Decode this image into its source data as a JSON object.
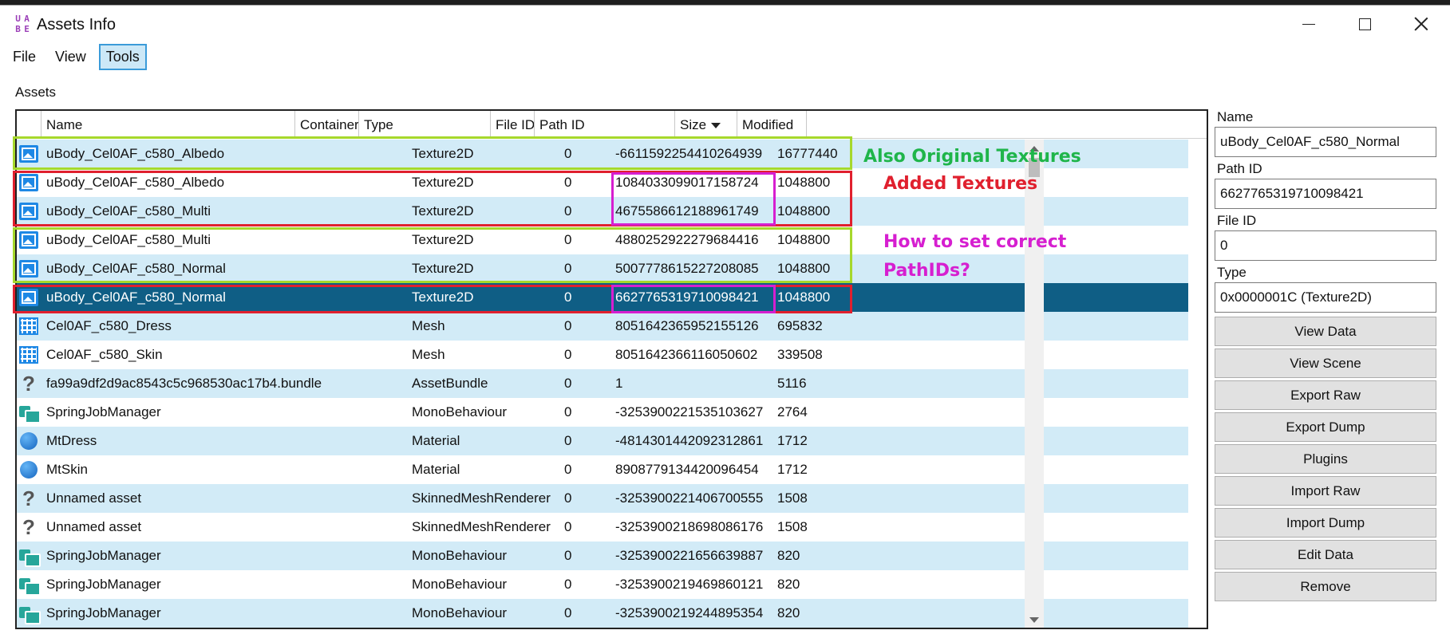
{
  "window": {
    "title": "Assets Info",
    "icon_letters": [
      "U",
      "A",
      "B",
      "E"
    ],
    "controls": [
      "minimize-icon",
      "maximize-icon",
      "close-icon"
    ]
  },
  "menu": {
    "items": [
      "File",
      "View",
      "Tools"
    ],
    "active": "Tools"
  },
  "assets_label": "Assets",
  "table": {
    "columns": [
      "Name",
      "Container",
      "Type",
      "File ID",
      "Path ID",
      "Size",
      "Modified"
    ],
    "sort_column": "Size",
    "rows": [
      {
        "icon": "texture-icon",
        "name": "uBody_Cel0AF_c580_Albedo",
        "container": "",
        "type": "Texture2D",
        "file_id": "0",
        "path_id": "-6611592254410264939",
        "size": "16777440"
      },
      {
        "icon": "texture-icon",
        "name": "uBody_Cel0AF_c580_Albedo",
        "container": "",
        "type": "Texture2D",
        "file_id": "0",
        "path_id": "1084033099017158724",
        "size": "1048800"
      },
      {
        "icon": "texture-icon",
        "name": "uBody_Cel0AF_c580_Multi",
        "container": "",
        "type": "Texture2D",
        "file_id": "0",
        "path_id": "4675586612188961749",
        "size": "1048800"
      },
      {
        "icon": "texture-icon",
        "name": "uBody_Cel0AF_c580_Multi",
        "container": "",
        "type": "Texture2D",
        "file_id": "0",
        "path_id": "4880252922279684416",
        "size": "1048800"
      },
      {
        "icon": "texture-icon",
        "name": "uBody_Cel0AF_c580_Normal",
        "container": "",
        "type": "Texture2D",
        "file_id": "0",
        "path_id": "5007778615227208085",
        "size": "1048800"
      },
      {
        "icon": "texture-icon",
        "name": "uBody_Cel0AF_c580_Normal",
        "container": "",
        "type": "Texture2D",
        "file_id": "0",
        "path_id": "6627765319710098421",
        "size": "1048800",
        "selected": true
      },
      {
        "icon": "mesh-icon",
        "name": "Cel0AF_c580_Dress",
        "container": "",
        "type": "Mesh",
        "file_id": "0",
        "path_id": "8051642365952155126",
        "size": "695832"
      },
      {
        "icon": "mesh-icon",
        "name": "Cel0AF_c580_Skin",
        "container": "",
        "type": "Mesh",
        "file_id": "0",
        "path_id": "8051642366116050602",
        "size": "339508"
      },
      {
        "icon": "unknown-icon",
        "name": "fa99a9df2d9ac8543c5c968530ac17b4.bundle",
        "container": "",
        "type": "AssetBundle",
        "file_id": "0",
        "path_id": "1",
        "size": "5116"
      },
      {
        "icon": "monobehaviour-icon",
        "name": "SpringJobManager",
        "container": "",
        "type": "MonoBehaviour",
        "file_id": "0",
        "path_id": "-3253900221535103627",
        "size": "2764"
      },
      {
        "icon": "material-icon",
        "name": "MtDress",
        "container": "",
        "type": "Material",
        "file_id": "0",
        "path_id": "-4814301442092312861",
        "size": "1712"
      },
      {
        "icon": "material-icon",
        "name": "MtSkin",
        "container": "",
        "type": "Material",
        "file_id": "0",
        "path_id": "8908779134420096454",
        "size": "1712"
      },
      {
        "icon": "unknown-icon",
        "name": "Unnamed asset",
        "container": "",
        "type": "SkinnedMeshRenderer",
        "file_id": "0",
        "path_id": "-3253900221406700555",
        "size": "1508"
      },
      {
        "icon": "unknown-icon",
        "name": "Unnamed asset",
        "container": "",
        "type": "SkinnedMeshRenderer",
        "file_id": "0",
        "path_id": "-3253900218698086176",
        "size": "1508"
      },
      {
        "icon": "monobehaviour-icon",
        "name": "SpringJobManager",
        "container": "",
        "type": "MonoBehaviour",
        "file_id": "0",
        "path_id": "-3253900221656639887",
        "size": "820"
      },
      {
        "icon": "monobehaviour-icon",
        "name": "SpringJobManager",
        "container": "",
        "type": "MonoBehaviour",
        "file_id": "0",
        "path_id": "-3253900219469860121",
        "size": "820"
      },
      {
        "icon": "monobehaviour-icon",
        "name": "SpringJobManager",
        "container": "",
        "type": "MonoBehaviour",
        "file_id": "0",
        "path_id": "-3253900219244895354",
        "size": "820"
      }
    ]
  },
  "annotations": {
    "original": "Also Original Textures",
    "added": "Added Textures",
    "question": "How to set correct PathIDs?",
    "question_line1": "How to set correct",
    "question_line2": "PathIDs?",
    "colors": {
      "green_box": "#a6d82c",
      "red_box": "#e0202e",
      "magenta_box": "#d61fd0",
      "green_text": "#1fb54a"
    }
  },
  "details": {
    "name_label": "Name",
    "name_value": "uBody_Cel0AF_c580_Normal",
    "path_id_label": "Path ID",
    "path_id_value": "6627765319710098421",
    "file_id_label": "File ID",
    "file_id_value": "0",
    "type_label": "Type",
    "type_value": "0x0000001C (Texture2D)"
  },
  "buttons": [
    "View Data",
    "View Scene",
    "Export Raw",
    "Export Dump",
    "Plugins",
    "Import Raw",
    "Import Dump",
    "Edit Data",
    "Remove"
  ],
  "colors": {
    "selected_row": "#0f5e85",
    "alt_row": "#d2ebf7",
    "menu_active": "#cce8f7"
  }
}
